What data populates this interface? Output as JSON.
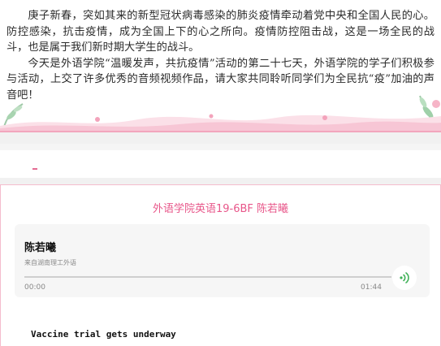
{
  "article": {
    "paragraphs": [
      "庚子新春，突如其来的新型冠状病毒感染的肺炎疫情牵动着党中央和全国人民的心。防控感染，抗击疫情，成为全国上下的心之所向。疫情防控阻击战，这是一场全民的战斗，也是属于我们新时期大学生的战斗。",
      "今天是外语学院“温暖发声，共抗疫情”活动的第二十七天，外语学院的学子们积极参与活动，上交了许多优秀的音频视频作品，请大家共同聆听同学们为全民抗“疫”加油的声音吧！"
    ]
  },
  "audio": {
    "section_title": "外语学院英语19-6BF  陈若曦",
    "name": "陈若曦",
    "source": "来自湖南理工外语",
    "time_start": "00:00",
    "time_end": "01:44",
    "progress": 0,
    "play_icon": "sound-wave-icon"
  },
  "content": {
    "heading": "Vaccine trial gets underway"
  },
  "colors": {
    "accent_pink": "#e8578a",
    "play_green": "#3fb157"
  }
}
